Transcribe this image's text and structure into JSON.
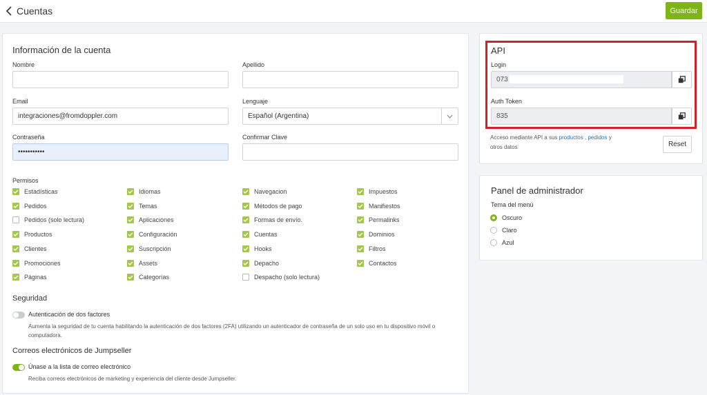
{
  "header": {
    "back_title": "Cuentas",
    "save_label": "Guardar"
  },
  "account": {
    "title": "Información de la cuenta",
    "nombre_label": "Nombre",
    "nombre_value": "",
    "apellido_label": "Apellido",
    "apellido_value": "",
    "email_label": "Email",
    "email_value": "integraciones@fromdoppler.com",
    "lenguaje_label": "Lenguaje",
    "lenguaje_value": "Español (Argentina)",
    "password_label": "Contraseña",
    "password_value": "•••••••••••",
    "confirm_label": "Confirmar Clave",
    "confirm_value": ""
  },
  "permissions": {
    "title": "Permisos",
    "columns": [
      [
        {
          "label": "Estadísticas",
          "checked": true
        },
        {
          "label": "Pedidos",
          "checked": true
        },
        {
          "label": "Pedidos (solo lectura)",
          "checked": false
        },
        {
          "label": "Productos",
          "checked": true
        },
        {
          "label": "Clientes",
          "checked": true
        },
        {
          "label": "Promociones",
          "checked": true
        },
        {
          "label": "Páginas",
          "checked": true
        }
      ],
      [
        {
          "label": "Idiomas",
          "checked": true
        },
        {
          "label": "Temas",
          "checked": true
        },
        {
          "label": "Aplicaciones",
          "checked": true
        },
        {
          "label": "Configuración",
          "checked": true
        },
        {
          "label": "Suscripción",
          "checked": true
        },
        {
          "label": "Assets",
          "checked": true
        },
        {
          "label": "Categorías",
          "checked": true
        }
      ],
      [
        {
          "label": "Navegacion",
          "checked": true
        },
        {
          "label": "Métodos de pago",
          "checked": true
        },
        {
          "label": "Formas de envío.",
          "checked": true
        },
        {
          "label": "Cuentas",
          "checked": true
        },
        {
          "label": "Hooks",
          "checked": true
        },
        {
          "label": "Depacho",
          "checked": true
        },
        {
          "label": "Despacho (solo lectura)",
          "checked": false
        }
      ],
      [
        {
          "label": "Impuestos",
          "checked": true
        },
        {
          "label": "Manifiestos",
          "checked": true
        },
        {
          "label": "Permalinks",
          "checked": true
        },
        {
          "label": "Dominios",
          "checked": true
        },
        {
          "label": "Filtros",
          "checked": true
        },
        {
          "label": "Contactos",
          "checked": true
        }
      ]
    ]
  },
  "security": {
    "title": "Seguridad",
    "twofa_label": "Autenticación de dos factores",
    "twofa_enabled": false,
    "twofa_desc_1": "Aumenta la seguridad de tu cuenta habilitando la autenticación de dos factores (2FA) utilizando un autenticador de contraseña de un solo uso en tu dispositivo móvil o",
    "twofa_desc_2": "computadora."
  },
  "emails": {
    "title": "Correos electrónicos de Jumpseller",
    "subscribe_label": "Únase a la lista de correo electrónico",
    "subscribe_enabled": true,
    "subscribe_desc": "Reciba correos electrónicos de marketing y experiencia del cliente desde Jumpseller."
  },
  "api": {
    "title": "API",
    "login_label": "Login",
    "login_value": "073",
    "token_label": "Auth Token",
    "token_value": "835",
    "note_prefix": "Acceso mediante API a sus",
    "note_link_1": "productos",
    "note_sep": ",",
    "note_link_2": "pedidos",
    "note_and": "y",
    "note_suffix": "otros datos",
    "reset_label": "Reset"
  },
  "admin": {
    "title": "Panel de administrador",
    "theme_label": "Tema del menú",
    "options": [
      {
        "label": "Oscuro",
        "selected": true
      },
      {
        "label": "Claro",
        "selected": false
      },
      {
        "label": "Azul",
        "selected": false
      }
    ]
  },
  "colors": {
    "accent": "#7fb418",
    "checkbox": "#a3c64b",
    "highlight": "#d0202a",
    "link": "#1d6fb8"
  }
}
